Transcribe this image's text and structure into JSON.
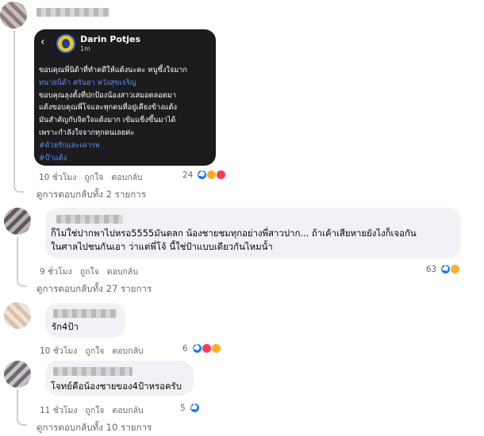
{
  "story": {
    "name": "Darin Potjes",
    "time": "1m",
    "back_icon": "‹",
    "lines": [
      {
        "text": "ขอบคุณพี่นิด้าที่ทำคดีให้แต้งนะคะ หนูซึ้งใจมาก",
        "link": false
      },
      {
        "text": "ทนายนิด้า ศรันยา หวังสุขเจริญ",
        "link": true
      },
      {
        "text": "ขอบคุณลุงตั้งที่ปกป้องน้องสาวเสมอตลอดมา",
        "link": false
      },
      {
        "text": "แต้งขอบคุณพี่โจและทุกคนที่อยู่เคียงข้างแต้ง",
        "link": false
      },
      {
        "text": "มันสำคัญกับจิตใจแต้งมาก เข้มแข็งขึ้นมาได้",
        "link": false
      },
      {
        "text": "เพราะกำลังใจจากทุกคนเลยค่ะ",
        "link": false
      },
      {
        "text": "#ด้วยรักและเคารพ",
        "link": true
      },
      {
        "text": "#ป้าแต้ง",
        "link": true
      }
    ]
  },
  "comments": [
    {
      "text_lines": [],
      "time": "10 ชั่วโมง",
      "like": "ถูกใจ",
      "reply": "ตอบกลับ",
      "reaction_count": "24",
      "reactions": [
        "like",
        "care",
        "love"
      ],
      "view_replies": "ดูการตอบกลับทั้ง 2 รายการ"
    },
    {
      "text_lines": [
        "ก็ไม่ใช่ปากพาไปหรอ5555มันตลก น้องชายชมทุกอย่างพี่สาวปาก... ถ้าเค้าเสียหายยังไงก็เจอกัน",
        "ในศาลไปชนกันเอา ว่าแต่พี่โจ้ นี้ใช่ป้าแบบเดียวกันไหมนั้า"
      ],
      "time": "9 ชั่วโมง",
      "like": "ถูกใจ",
      "reply": "ตอบกลับ",
      "reaction_count": "63",
      "reactions": [
        "like",
        "haha"
      ],
      "view_replies": "ดูการตอบกลับทั้ง 27 รายการ"
    },
    {
      "text_lines": [
        "รัก4ป้า"
      ],
      "time": "10 ชั่วโมง",
      "like": "ถูกใจ",
      "reply": "ตอบกลับ",
      "reaction_count": "6",
      "reactions": [
        "like",
        "love",
        "care"
      ],
      "view_replies": ""
    },
    {
      "text_lines": [
        "โจทย์คือน้องชายของ4ป้าหรอครับ"
      ],
      "time": "11 ชั่วโมง",
      "like": "ถูกใจ",
      "reply": "ตอบกลับ",
      "reaction_count": "5",
      "reactions": [
        "like"
      ],
      "view_replies": "ดูการตอบกลับทั้ง 10 รายการ"
    }
  ],
  "colors": {
    "bubble": "#f0f2f5",
    "meta_text": "#65676b",
    "link": "#5b8ef0",
    "like_blue": "#1877f2",
    "love_red": "#f33e58",
    "haha_yellow": "#f7b125",
    "story_bg": "#1c1c1e"
  }
}
